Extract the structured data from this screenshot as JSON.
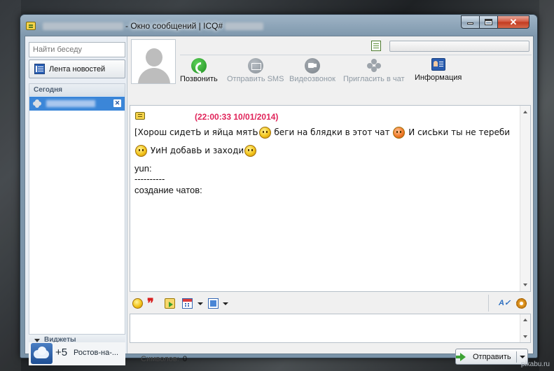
{
  "window": {
    "title": "- Окно сообщений | ICQ#"
  },
  "sidebar": {
    "search_placeholder": "Найти беседу",
    "news_label": "Лента новостей",
    "today_label": "Сегодня",
    "widgets_label": "Виджеты",
    "weather": {
      "temp": "+5",
      "city": "Ростов-на-..."
    }
  },
  "actions": [
    {
      "label": "Позвонить",
      "enabled": true,
      "icon": "phone-icon"
    },
    {
      "label": "Отправить SMS",
      "enabled": false,
      "icon": "sms-icon"
    },
    {
      "label": "Видеозвонок",
      "enabled": false,
      "icon": "video-icon"
    },
    {
      "label": "Пригласить в чат",
      "enabled": false,
      "icon": "invite-icon"
    },
    {
      "label": "Информация",
      "enabled": true,
      "icon": "info-icon"
    }
  ],
  "chat": {
    "timestamp": "(22:00:33 10/01/2014)",
    "lines": {
      "l1a": "[Хорош сидетЬ и яйца мятЬ",
      "l1b": "беги на блядки в этот чат",
      "l1c": "И сисЬки ты не тереби",
      "l2": "УиН добавЬ и заходи",
      "l3": "yun:",
      "l4": "----------",
      "l5": "создание чатов:"
    }
  },
  "footer": {
    "chars_label": "Символов:",
    "chars_value": "0",
    "send_label": "Отправить"
  },
  "watermark": "pikabu.ru",
  "colors": {
    "timestamp": "#e0245a",
    "selection": "#3b86d8",
    "call_green": "#1e8d1e"
  }
}
